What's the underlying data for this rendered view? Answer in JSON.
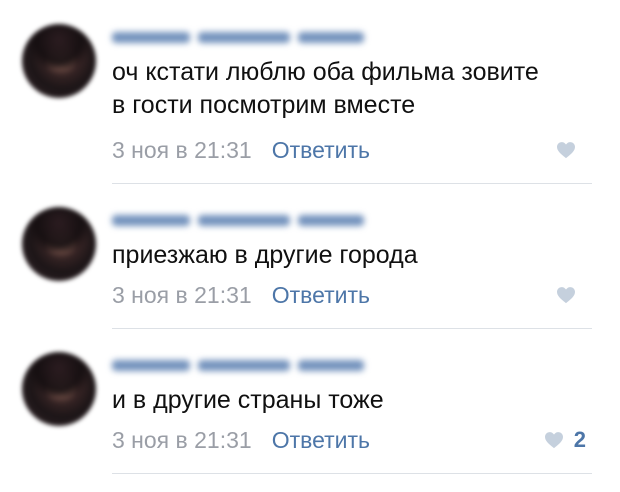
{
  "comments": [
    {
      "text": "оч кстати люблю оба фильма зовите\nв гости посмотрим вместе",
      "date": "3 ноя в 21:31",
      "reply_label": "Ответить",
      "like_count": ""
    },
    {
      "text": "приезжаю в другие города",
      "date": "3 ноя в 21:31",
      "reply_label": "Ответить",
      "like_count": ""
    },
    {
      "text": "и в другие страны тоже",
      "date": "3 ноя в 21:31",
      "reply_label": "Ответить",
      "like_count": "2"
    }
  ],
  "colors": {
    "link": "#4d76a8",
    "muted": "#9a9ea6",
    "heart": "#c5d0dd",
    "divider": "#dde1e6"
  },
  "icons": {
    "like": "heart-icon"
  }
}
